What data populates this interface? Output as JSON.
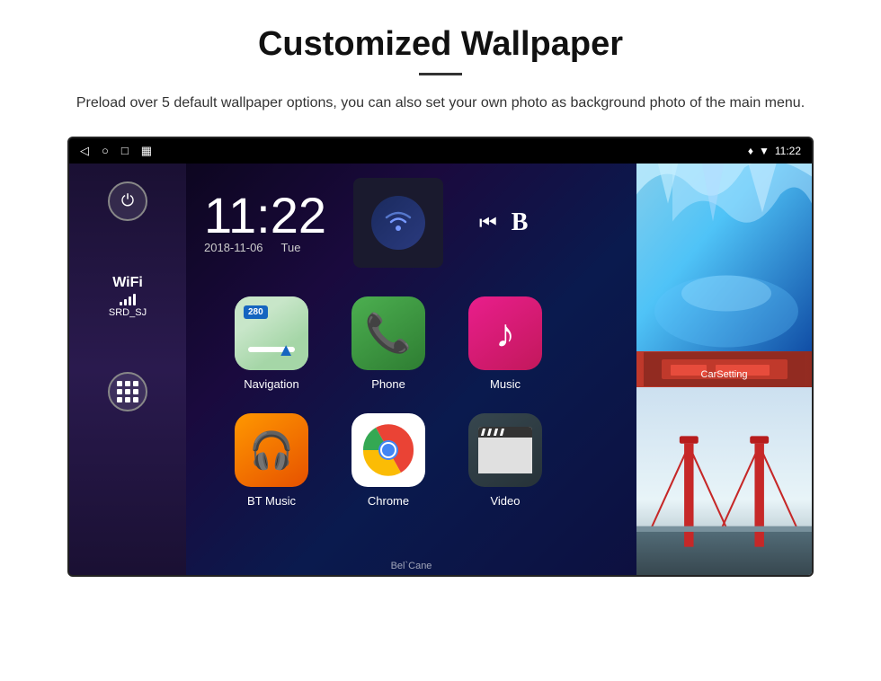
{
  "page": {
    "title": "Customized Wallpaper",
    "divider": "—",
    "description": "Preload over 5 default wallpaper options, you can also set your own photo as background photo of the main menu."
  },
  "device": {
    "status_bar": {
      "nav_back": "◁",
      "nav_home": "○",
      "nav_recents": "□",
      "nav_screenshot": "▦",
      "time": "11:22",
      "signal_icon": "♦",
      "wifi_icon": "▼"
    },
    "clock": {
      "time": "11:22",
      "date": "2018-11-06",
      "day": "Tue"
    },
    "wifi": {
      "label": "WiFi",
      "network": "SRD_SJ"
    },
    "apps": [
      {
        "label": "Navigation",
        "icon": "navigation"
      },
      {
        "label": "Phone",
        "icon": "phone"
      },
      {
        "label": "Music",
        "icon": "music"
      },
      {
        "label": "BT Music",
        "icon": "bt-music"
      },
      {
        "label": "Chrome",
        "icon": "chrome"
      },
      {
        "label": "Video",
        "icon": "video"
      }
    ],
    "car_setting_label": "CarSetting",
    "watermark": "Bel`Cane"
  }
}
